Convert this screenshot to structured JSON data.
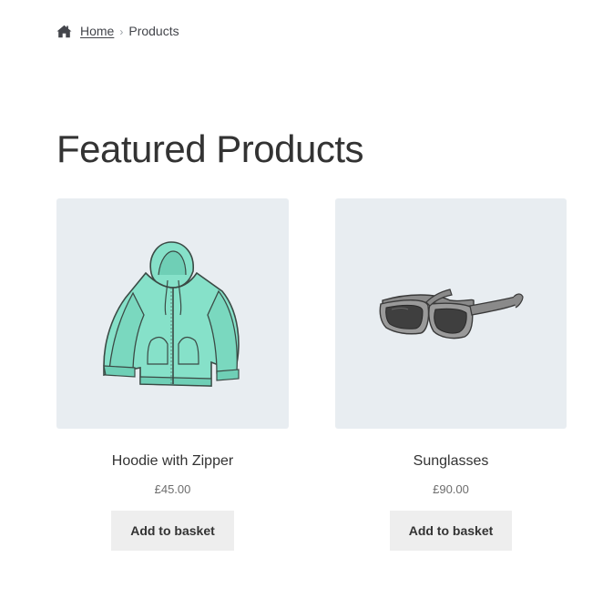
{
  "breadcrumb": {
    "home_label": "Home",
    "separator": "›",
    "current_label": "Products"
  },
  "page": {
    "title": "Featured Products"
  },
  "products": [
    {
      "name": "Hoodie with Zipper",
      "price": "£45.00",
      "button_label": "Add to basket",
      "image": "hoodie-with-zipper-image"
    },
    {
      "name": "Sunglasses",
      "price": "£90.00",
      "button_label": "Add to basket",
      "image": "sunglasses-image"
    }
  ],
  "colors": {
    "image_background": "#e8edf1",
    "button_background": "#eeeeee",
    "text": "#43454b",
    "hoodie": "#86e1c9"
  }
}
